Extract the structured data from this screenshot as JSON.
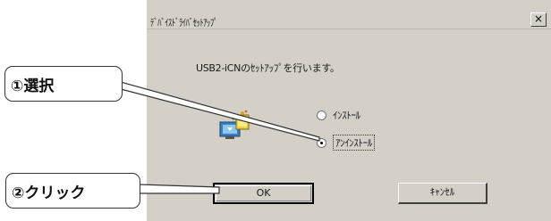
{
  "dialog": {
    "title": "ﾃﾞﾊﾞｲｽﾄﾞﾗｲﾊﾞｾｯﾄｱｯﾌﾟ",
    "close_glyph": "×",
    "message": "USB2-iCNのｾｯﾄｱｯﾌﾟを行います。",
    "icon": "setup-wizard-icon",
    "options": [
      {
        "label": "ｲﾝｽﾄｰﾙ",
        "checked": false
      },
      {
        "label": "ｱﾝｲﾝｽﾄｰﾙ",
        "checked": true
      }
    ],
    "ok_label": "OK",
    "cancel_label": "ｷｬﾝｾﾙ"
  },
  "annotations": {
    "step1": "①選択",
    "step2": "②クリック"
  }
}
